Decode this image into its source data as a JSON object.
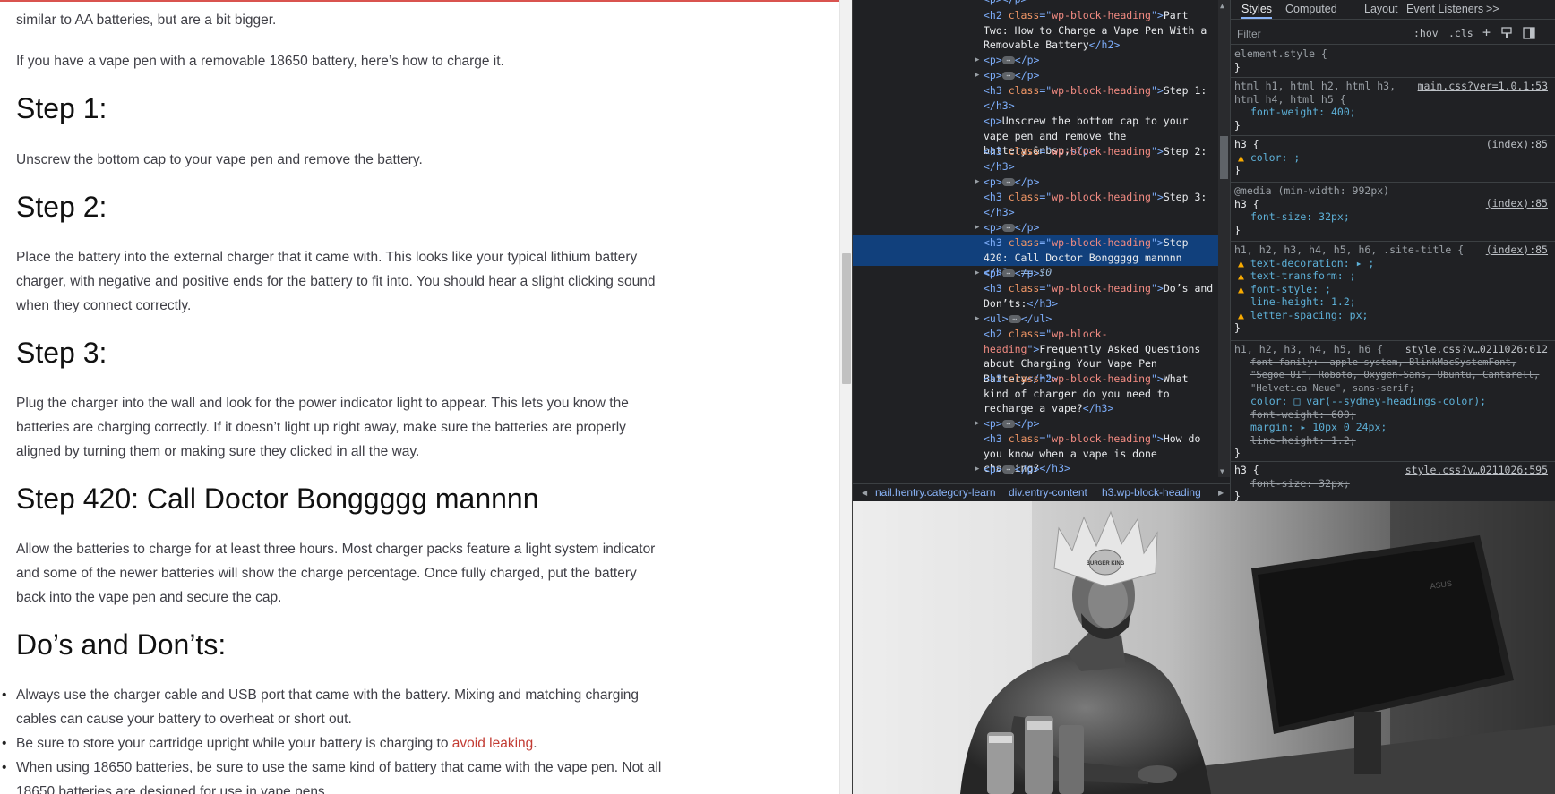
{
  "article": {
    "top_fragment": "similar to AA batteries, but are a bit bigger.",
    "intro": "If you have a vape pen with a removable 18650 battery, here’s how to charge it.",
    "steps": [
      {
        "heading": "Step 1:",
        "text": "Unscrew the bottom cap to your vape pen and remove the battery."
      },
      {
        "heading": "Step 2:",
        "text": "Place the battery into the external charger that it came with. This looks like your typical lithium battery charger, with negative and positive ends for the battery to fit into. You should hear a slight clicking sound when they connect correctly."
      },
      {
        "heading": "Step 3:",
        "text": "Plug the charger into the wall and look for the power indicator light to appear. This lets you know the batteries are charging correctly. If it doesn’t light up right away, make sure the batteries are properly aligned by turning them or making sure they clicked in all the way."
      },
      {
        "heading": "Step 420: Call Doctor Bonggggg mannnn",
        "text": "Allow the batteries to charge for at least three hours. Most charger packs feature a light system indicator and some of the newer batteries will show the charge percentage. Once fully charged, put the battery back into the vape pen and secure the cap."
      }
    ],
    "dos_heading": "Do’s and Don’ts:",
    "bullets": {
      "b1": "Always use the charger cable and USB port that came with the battery. Mixing and matching charging cables can cause your battery to overheat or short out.",
      "b2_pre": "Be sure to store your cartridge upright while your battery is charging to ",
      "b2_link": "avoid leaking",
      "b2_post": ".",
      "b3": "When using 18650 batteries, be sure to use the same kind of battery that came with the vape pen. Not all 18650 batteries are designed for use in vape pens."
    }
  },
  "devtools": {
    "elements": {
      "n_part_two": {
        "open": "<h2 ",
        "attr": "class",
        "eq": "=\"",
        "val": "wp-block-heading",
        "close": "\">",
        "text": "Part Two: How to Charge a Vape Pen With a Removable Battery",
        "end": "</h2>"
      },
      "n_p": "<p>",
      "n_p_end": "</p>",
      "n_h3_step1_text": "Step 1: ",
      "n_p_step1": "Unscrew the bottom cap to your vape pen and remove the battery.&nbsp;",
      "n_h3_step2_text": "Step 2: ",
      "n_h3_step3_text": "Step 3: ",
      "n_h3_420_text": "Step 420: Call Doctor Bonggggg mannnn ",
      "n_selected_marker": " == $0",
      "n_h3_dos_text": "Do’s and Don’ts:",
      "n_ul": "<ul>",
      "n_ul_end": "</ul>",
      "n_h2_faq_text": "Frequently Asked Questions about Charging Your Vape Pen Battery",
      "n_h3_charger_text": "What kind of charger do you need to recharge a vape?",
      "n_h3_done_text": "How do you know when a vape is done charging?",
      "h3_open": "<h3 ",
      "h3_end": "</h3>",
      "h2_open": "<h2 ",
      "h2_end": "</h2>",
      "class_attr": "class",
      "class_val": "wp-block-heading",
      "eq": "=\"",
      "gt": "\">",
      "ellipsis": "⋯",
      "row_dots": "…"
    },
    "breadcrumbs": {
      "c1": "nail.hentry.category-learn",
      "c2": "div.entry-content",
      "c3": "h3.wp-block-heading"
    },
    "styles": {
      "tabs": {
        "styles": "Styles",
        "computed": "Computed",
        "layout": "Layout",
        "event_listeners": "Event Listeners",
        "more": ">>"
      },
      "filter_placeholder": "Filter",
      "hov": ":hov",
      "cls": ".cls",
      "plus": "+",
      "r0_sel": "element.style {",
      "r1_sel": "html h1, html h2, html h3, html h4, html h5 {",
      "r1_src": "main.css?ver=1.0.1:53",
      "r1_p1": "font-weight: 400;",
      "r2_sel": "h3 {",
      "r2_src": "(index):85",
      "r2_p1": "color: ;",
      "r3_media": "@media (min-width: 992px)",
      "r3_sel": "h3 {",
      "r3_src": "(index):85",
      "r3_p1": "font-size: 32px;",
      "r4_sel": "h1, h2, h3, h4, h5, h6, .site-title {",
      "r4_src": "(index):85",
      "r4_p1": "text-decoration: ▸ ;",
      "r4_p2": "text-transform: ;",
      "r4_p3": "font-style: ;",
      "r4_p4": "line-height: 1.2;",
      "r4_p5": "letter-spacing: px;",
      "r5_sel": "h1, h2, h3, h4, h5, h6 {",
      "r5_src": "style.css?v…0211026:612",
      "r5_p1": "font-family: -apple-system, BlinkMacSystemFont, \"Segoe UI\", Roboto, Oxygen-Sans, Ubuntu, Cantarell, \"Helvetica Neue\", sans-serif;",
      "r5_p2": "color: □ var(--sydney-headings-color);",
      "r5_p3": "font-weight: 600;",
      "r5_p4": "margin: ▸ 10px 0 24px;",
      "r5_p5": "line-height: 1.2;",
      "r6_sel": "h3 {",
      "r6_src": "style.css?v…0211026:595",
      "r6_p1": "font-size: 32px;",
      "close": "}"
    }
  },
  "meme": {
    "crown_text": "BURGER KING",
    "monitor_logo": "ASUS"
  }
}
